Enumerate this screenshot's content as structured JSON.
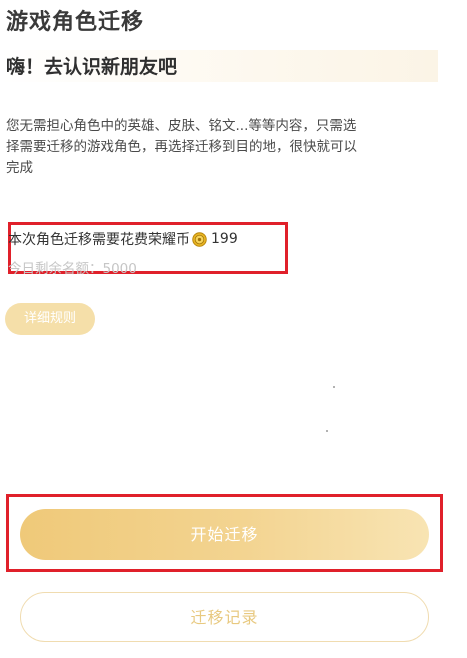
{
  "header": {
    "title": "游戏角色迁移",
    "greeting": "嗨！去认识新朋友吧"
  },
  "description": {
    "line1": "您无需担心角色中的英雄、皮肤、铭文...等等内容，只需选",
    "line2": "择需要迁移的游戏角色，再选择迁移到目的地，很快就可以",
    "line3": "完成"
  },
  "cost": {
    "label": "本次角色迁移需要花费荣耀币",
    "coin_icon": "coin-icon",
    "amount": "199",
    "quota": "今日剩余名额：5000"
  },
  "buttons": {
    "rules": "详细规则",
    "start": "开始迁移",
    "history": "迁移记录"
  },
  "colors": {
    "accent_gold": "#efc979",
    "highlight_red": "#e0202a",
    "muted_text": "#c6c6c6"
  }
}
